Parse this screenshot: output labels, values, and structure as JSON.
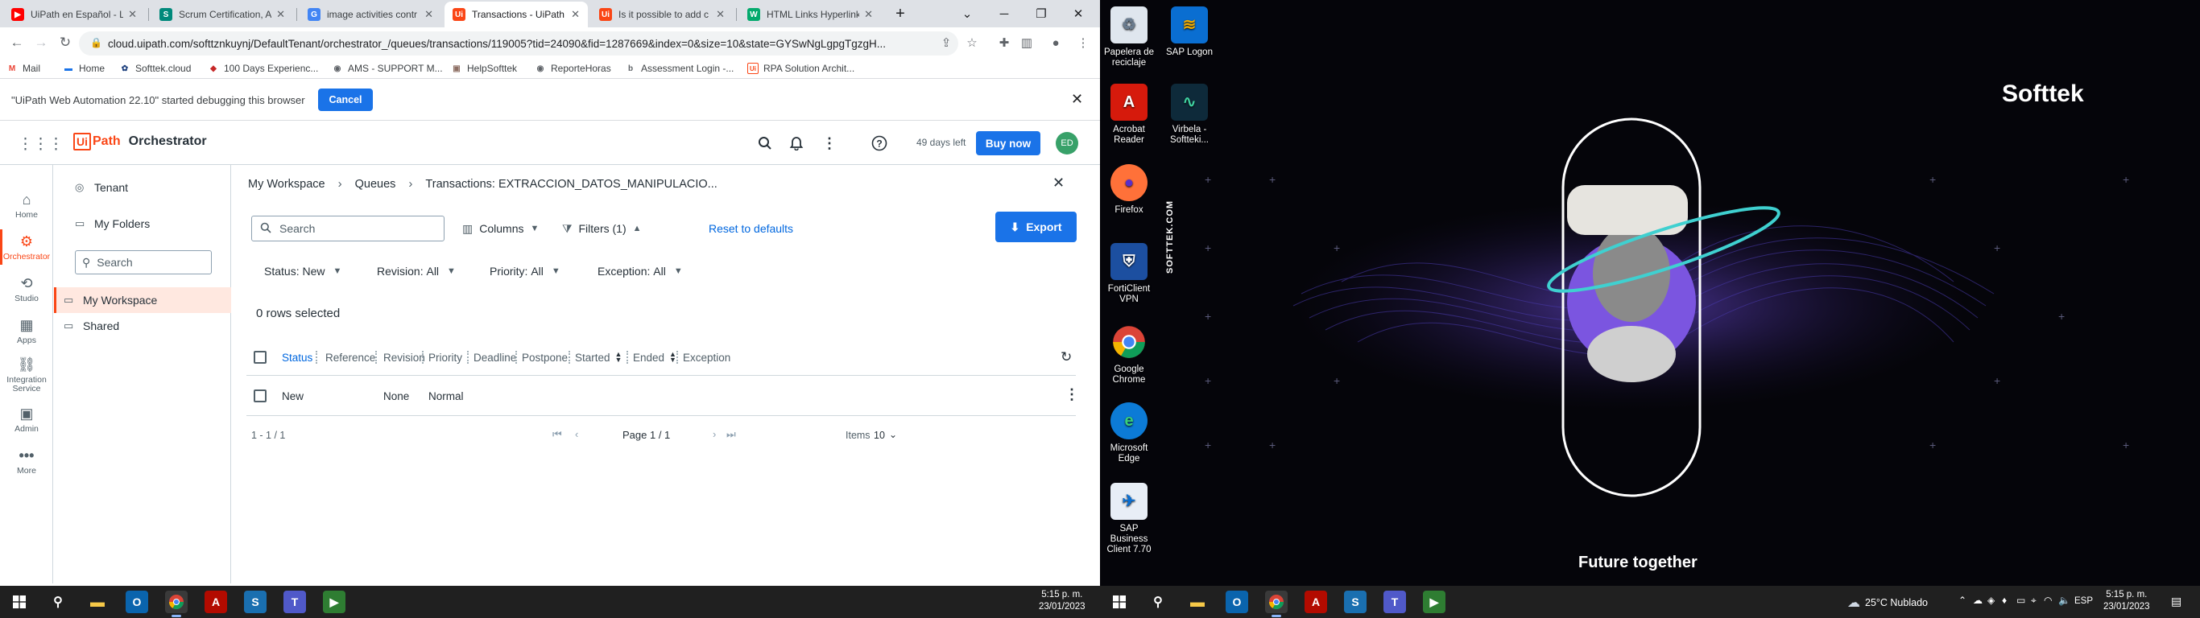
{
  "browser": {
    "tabs": [
      {
        "label": "UiPath en Español - Le",
        "color": "#ff0000",
        "glyph": "▶"
      },
      {
        "label": "Scrum Certification, A",
        "color": "#00897b",
        "glyph": "S"
      },
      {
        "label": "image activities contr",
        "color": "#4285f4",
        "glyph": "G"
      },
      {
        "label": "Transactions - UiPath",
        "color": "#fa4616",
        "glyph": "Ui"
      },
      {
        "label": "Is it possible to add c",
        "color": "#fa4616",
        "glyph": "Ui"
      },
      {
        "label": "HTML Links Hyperlink",
        "color": "#04aa6d",
        "glyph": "W"
      }
    ],
    "new_tab": "+",
    "url": "cloud.uipath.com/softtznkuynj/DefaultTenant/orchestrator_/queues/transactions/119005?tid=24090&fid=1287669&index=0&size=10&state=GYSwNgLgpgTgzgH...",
    "bookmarks": [
      {
        "label": "Mail",
        "color": "#ea4335",
        "glyph": "M"
      },
      {
        "label": "Home",
        "color": "#1a73e8",
        "glyph": "▬"
      },
      {
        "label": "Softtek.cloud",
        "color": "#1a3d7c",
        "glyph": "✿"
      },
      {
        "label": "100 Days Experienc...",
        "color": "#c62828",
        "glyph": "◆"
      },
      {
        "label": "AMS - SUPPORT M...",
        "color": "#5f6368",
        "glyph": "◉"
      },
      {
        "label": "HelpSofttek",
        "color": "#8d6e63",
        "glyph": "▣"
      },
      {
        "label": "ReporteHoras",
        "color": "#5f6368",
        "glyph": "◉"
      },
      {
        "label": "Assessment Login -...",
        "color": "#5f6368",
        "glyph": "b"
      },
      {
        "label": "RPA Solution Archit...",
        "color": "#fa4616",
        "glyph": "Ui"
      }
    ],
    "debug_message": "\"UiPath Web Automation 22.10\" started debugging this browser",
    "debug_cancel": "Cancel"
  },
  "orchestrator": {
    "brand_ui": "Ui",
    "brand_path": "Path",
    "product": "Orchestrator",
    "days_left": "49 days left",
    "buy_now": "Buy now",
    "avatar_initials": "ED",
    "rail": [
      {
        "label": "Home",
        "icon": "home-icon"
      },
      {
        "label": "Orchestrator",
        "icon": "orchestrator-icon"
      },
      {
        "label": "Studio",
        "icon": "studio-icon"
      },
      {
        "label": "Apps",
        "icon": "apps-icon"
      },
      {
        "label": "Integration Service",
        "icon": "integration-icon"
      },
      {
        "label": "Admin",
        "icon": "admin-icon"
      },
      {
        "label": "More",
        "icon": "more-icon"
      }
    ],
    "folders": {
      "tenant": "Tenant",
      "my_folders": "My Folders",
      "search_placeholder": "Search",
      "items": [
        "My Workspace",
        "Shared"
      ]
    },
    "breadcrumbs": [
      "My Workspace",
      "Queues",
      "Transactions: EXTRACCION_DATOS_MANIPULACIO..."
    ],
    "toolbar": {
      "search_placeholder": "Search",
      "columns": "Columns",
      "filters": "Filters (1)",
      "reset": "Reset to defaults",
      "export": "Export"
    },
    "filters": [
      {
        "label": "Status:",
        "value": "New"
      },
      {
        "label": "Revision:",
        "value": "All"
      },
      {
        "label": "Priority:",
        "value": "All"
      },
      {
        "label": "Exception:",
        "value": "All"
      }
    ],
    "rows_selected": "0 rows selected",
    "columns": [
      "Status",
      "Reference",
      "Revision",
      "Priority",
      "Deadline",
      "Postpone",
      "Started",
      "Ended",
      "Exception"
    ],
    "rows": [
      {
        "Status": "New",
        "Reference": "",
        "Revision": "None",
        "Priority": "Normal",
        "Deadline": "",
        "Postpone": "",
        "Started": "",
        "Ended": "",
        "Exception": ""
      }
    ],
    "pager": {
      "count": "1 - 1 / 1",
      "page": "Page 1 / 1",
      "items_label": "Items",
      "items_value": "10"
    }
  },
  "taskbar_left": {
    "time": "5:15 p. m.",
    "date": "23/01/2023"
  },
  "desktop": {
    "icons": [
      {
        "label": "Papelera de reciclaje",
        "icon": "recycle-bin-icon"
      },
      {
        "label": "SAP Logon",
        "icon": "sap-logon-icon"
      },
      {
        "label": "Acrobat Reader",
        "icon": "acrobat-icon"
      },
      {
        "label": "Virbela - Softteki...",
        "icon": "virbela-icon"
      },
      {
        "label": "Firefox",
        "icon": "firefox-icon"
      },
      {
        "label": "FortiClient VPN",
        "icon": "forticlient-icon"
      },
      {
        "label": "Google Chrome",
        "icon": "chrome-icon"
      },
      {
        "label": "Microsoft Edge",
        "icon": "edge-icon"
      },
      {
        "label": "SAP Business Client 7.70",
        "icon": "sap-business-client-icon"
      }
    ],
    "side_text": "SOFTTEK.COM",
    "logo": "Softtek",
    "tagline": "Future together"
  },
  "taskbar_right": {
    "weather": "25°C  Nublado",
    "lang": "ESP",
    "time": "5:15 p. m.",
    "date": "23/01/2023"
  }
}
